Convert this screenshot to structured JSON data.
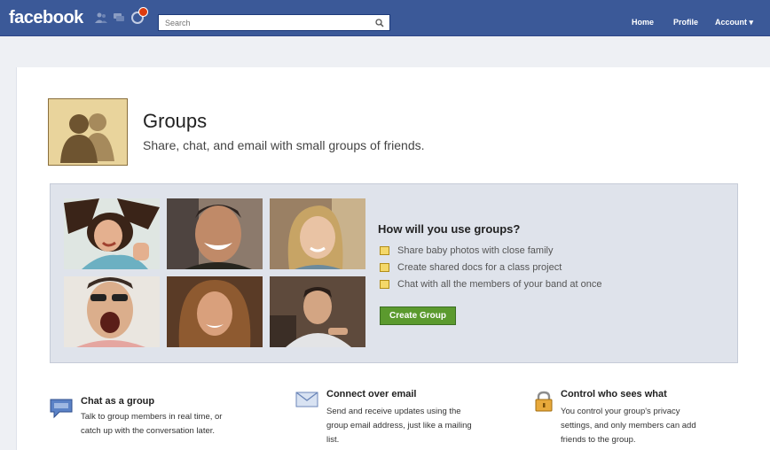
{
  "topbar": {
    "logo": "facebook",
    "search_placeholder": "Search",
    "nav": {
      "home": "Home",
      "profile": "Profile",
      "account": "Account ▾"
    },
    "jewels": [
      "friends-requests-icon",
      "messages-icon",
      "notifications-icon"
    ]
  },
  "header": {
    "title": "Groups",
    "subtitle": "Share, chat, and email with small groups of friends."
  },
  "promo": {
    "heading": "How will you use groups?",
    "uses": [
      "Share baby photos with close family",
      "Create shared docs for a class project",
      "Chat with all the members of your band at once"
    ],
    "button": "Create Group"
  },
  "features": [
    {
      "title": "Chat as a group",
      "lines": [
        "Talk to group members in real time, or",
        "catch up with the conversation later."
      ],
      "icon": "chat-bubble-icon"
    },
    {
      "title": "Connect over email",
      "lines": [
        "Send and receive updates using the",
        "group email address, just like a mailing",
        "list."
      ],
      "icon": "envelope-icon"
    },
    {
      "title": "Control who sees what",
      "lines": [
        "You control your group's privacy",
        "settings, and only members can add",
        "friends to the group."
      ],
      "icon": "lock-icon"
    }
  ],
  "colors": {
    "topbar": "#3b5998",
    "promo_bg": "#dfe3eb",
    "button": "#5b9a2e"
  }
}
